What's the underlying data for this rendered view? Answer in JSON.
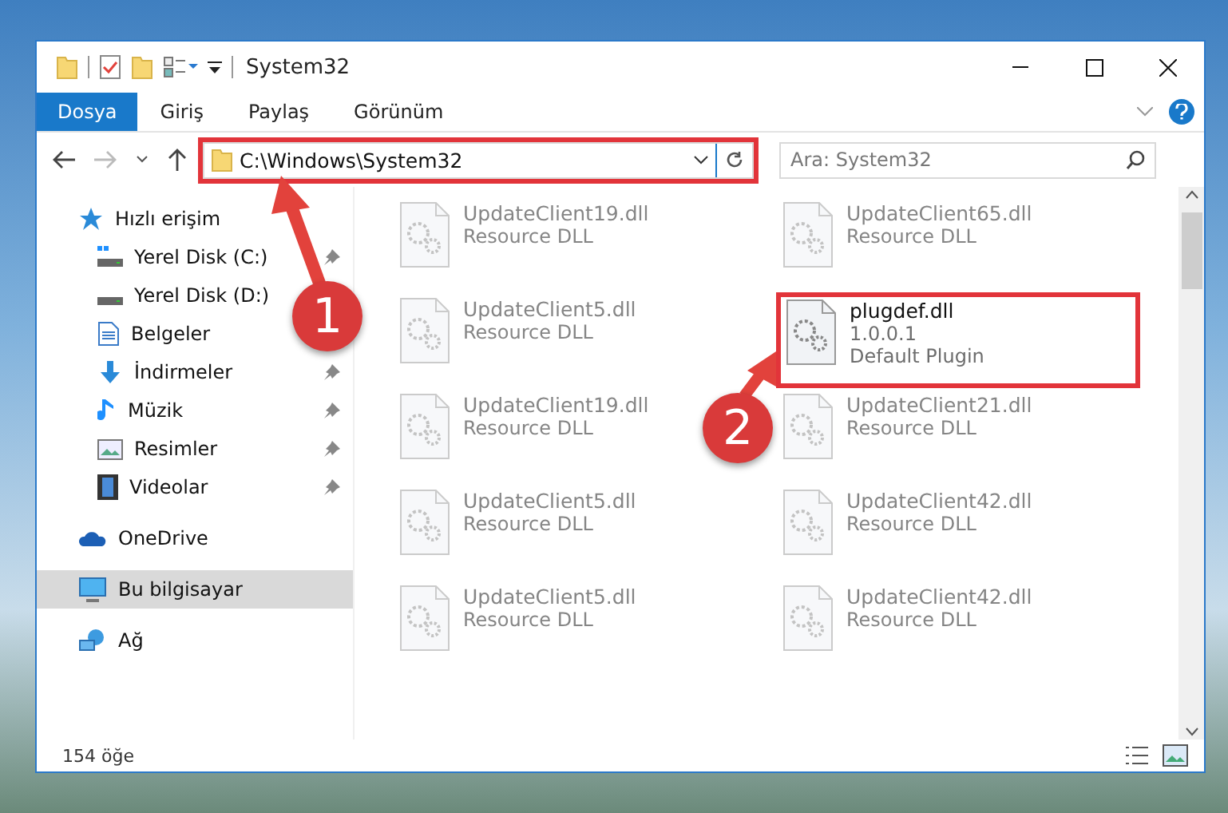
{
  "window": {
    "title": "System32"
  },
  "ribbon_tabs": [
    {
      "label": "Dosya",
      "kind": "file"
    },
    {
      "label": "Giriş",
      "kind": "tab"
    },
    {
      "label": "Paylaş",
      "kind": "tab"
    },
    {
      "label": "Görünüm",
      "kind": "tab"
    }
  ],
  "address_bar": {
    "value": "C:\\Windows\\System32",
    "marked": true
  },
  "search": {
    "placeholder": "Ara: System32"
  },
  "sidebar": {
    "items": [
      {
        "label": "Hızlı erişim",
        "kind": "group",
        "pinned": false,
        "selected": false
      },
      {
        "label": "Yerel Disk (C:)",
        "kind": "item",
        "pinned": true,
        "selected": false
      },
      {
        "label": "Yerel Disk (D:)",
        "kind": "item",
        "pinned": false,
        "selected": false
      },
      {
        "label": "Belgeler",
        "kind": "item",
        "pinned": false,
        "selected": false
      },
      {
        "label": "İndirmeler",
        "kind": "item",
        "pinned": true,
        "selected": false
      },
      {
        "label": "Müzik",
        "kind": "item",
        "pinned": true,
        "selected": false
      },
      {
        "label": "Resimler",
        "kind": "item",
        "pinned": true,
        "selected": false
      },
      {
        "label": "Videolar",
        "kind": "item",
        "pinned": true,
        "selected": false
      },
      {
        "label": "OneDrive",
        "kind": "group",
        "pinned": false,
        "selected": false
      },
      {
        "label": "Bu bilgisayar",
        "kind": "group",
        "pinned": false,
        "selected": true
      },
      {
        "label": "Ağ",
        "kind": "group",
        "pinned": false,
        "selected": false
      }
    ]
  },
  "files": [
    {
      "name": "UpdateClient19.dll",
      "details": [
        "Resource DLL"
      ],
      "blurred": true,
      "marked": false
    },
    {
      "name": "UpdateClient65.dll",
      "details": [
        "Resource DLL"
      ],
      "blurred": true,
      "marked": false
    },
    {
      "name": "UpdateClient5.dll",
      "details": [
        "Resource DLL"
      ],
      "blurred": true,
      "marked": false
    },
    {
      "name": "plugdef.dll",
      "details": [
        "1.0.0.1",
        "Default Plugin"
      ],
      "blurred": false,
      "marked": true
    },
    {
      "name": "UpdateClient19.dll",
      "details": [
        "Resource DLL"
      ],
      "blurred": true,
      "marked": false
    },
    {
      "name": "UpdateClient21.dll",
      "details": [
        "Resource DLL"
      ],
      "blurred": true,
      "marked": false
    },
    {
      "name": "UpdateClient5.dll",
      "details": [
        "Resource DLL"
      ],
      "blurred": true,
      "marked": false
    },
    {
      "name": "UpdateClient42.dll",
      "details": [
        "Resource DLL"
      ],
      "blurred": true,
      "marked": false
    },
    {
      "name": "UpdateClient5.dll",
      "details": [
        "Resource DLL"
      ],
      "blurred": true,
      "marked": false
    },
    {
      "name": "UpdateClient42.dll",
      "details": [
        "Resource DLL"
      ],
      "blurred": true,
      "marked": false
    }
  ],
  "status_bar": {
    "count": "154 öğe"
  },
  "annotations": [
    {
      "number": "1"
    },
    {
      "number": "2"
    }
  ]
}
